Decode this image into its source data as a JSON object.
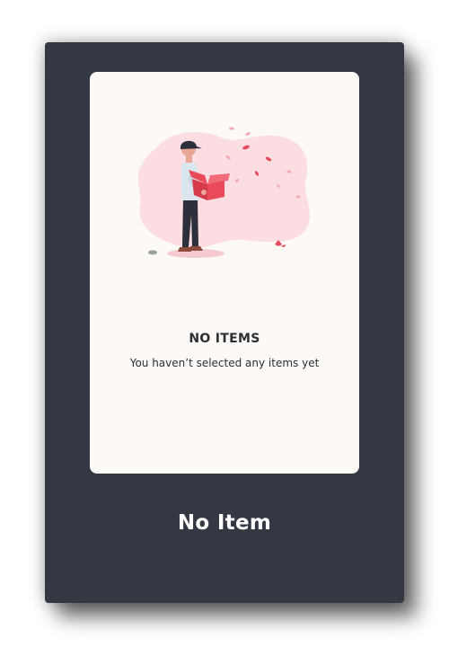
{
  "empty_state": {
    "title": "NO ITEMS",
    "message": "You haven’t selected any items yet",
    "illustration": "person-opening-box-illustration"
  },
  "caption": "No Item",
  "colors": {
    "frame": "#333842",
    "card": "#fcf9f7",
    "blob": "#fbdde2",
    "accent": "#e84a5a",
    "text": "#2b2e34",
    "caption_text": "#ffffff"
  }
}
